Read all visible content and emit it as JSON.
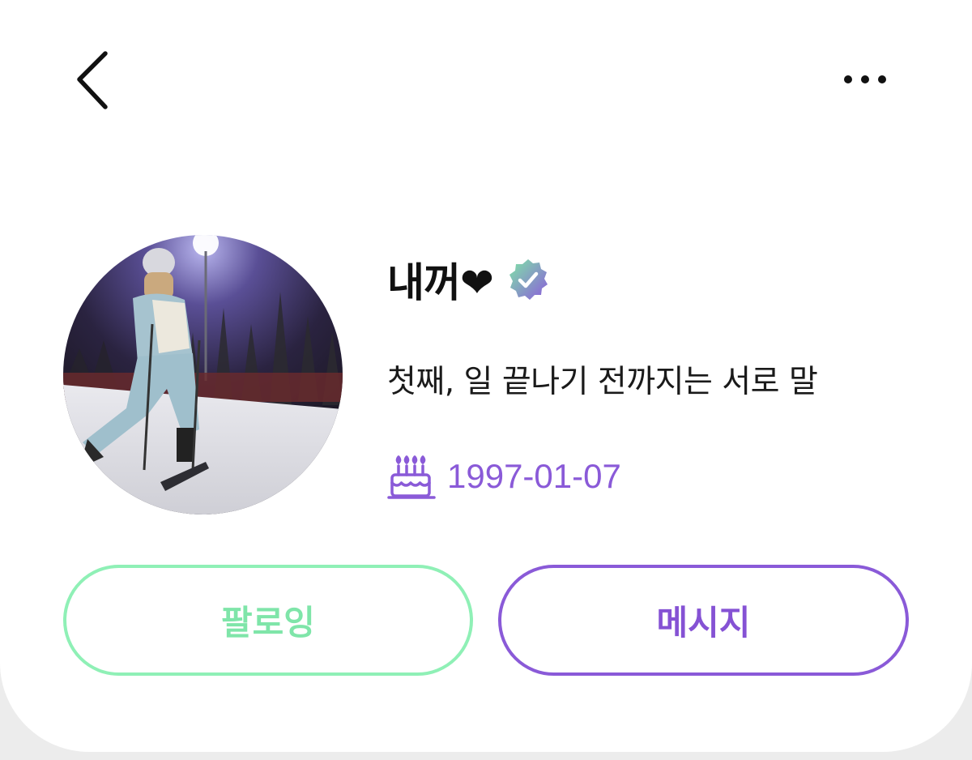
{
  "header": {
    "back_icon": "chevron-left-icon",
    "more_icon": "more-horizontal-icon"
  },
  "profile": {
    "avatar_description": "profile-photo",
    "name": "내꺼❤",
    "verified_icon": "verified-badge-icon",
    "bio": "첫째, 일 끝나기 전까지는 서로 말",
    "birthday_icon": "birthday-cake-icon",
    "birthday": "1997-01-07"
  },
  "actions": {
    "follow_label": "팔로잉",
    "message_label": "메시지"
  },
  "colors": {
    "follow_accent": "#8ff0b6",
    "message_accent": "#8a5ad8",
    "birthday_text": "#8a5ad8"
  }
}
